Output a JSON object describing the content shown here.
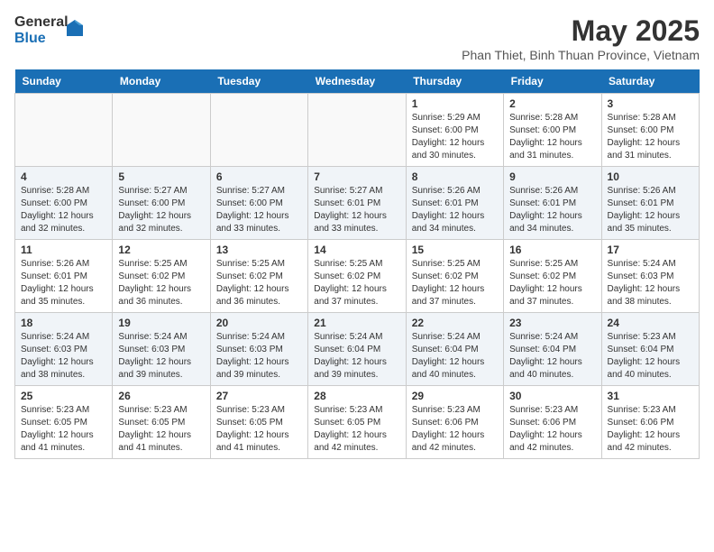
{
  "logo": {
    "text_general": "General",
    "text_blue": "Blue"
  },
  "title": "May 2025",
  "subtitle": "Phan Thiet, Binh Thuan Province, Vietnam",
  "days": [
    "Sunday",
    "Monday",
    "Tuesday",
    "Wednesday",
    "Thursday",
    "Friday",
    "Saturday"
  ],
  "weeks": [
    {
      "cells": [
        {
          "date": "",
          "info": ""
        },
        {
          "date": "",
          "info": ""
        },
        {
          "date": "",
          "info": ""
        },
        {
          "date": "",
          "info": ""
        },
        {
          "date": "1",
          "info": "Sunrise: 5:29 AM\nSunset: 6:00 PM\nDaylight: 12 hours\nand 30 minutes."
        },
        {
          "date": "2",
          "info": "Sunrise: 5:28 AM\nSunset: 6:00 PM\nDaylight: 12 hours\nand 31 minutes."
        },
        {
          "date": "3",
          "info": "Sunrise: 5:28 AM\nSunset: 6:00 PM\nDaylight: 12 hours\nand 31 minutes."
        }
      ]
    },
    {
      "cells": [
        {
          "date": "4",
          "info": "Sunrise: 5:28 AM\nSunset: 6:00 PM\nDaylight: 12 hours\nand 32 minutes."
        },
        {
          "date": "5",
          "info": "Sunrise: 5:27 AM\nSunset: 6:00 PM\nDaylight: 12 hours\nand 32 minutes."
        },
        {
          "date": "6",
          "info": "Sunrise: 5:27 AM\nSunset: 6:00 PM\nDaylight: 12 hours\nand 33 minutes."
        },
        {
          "date": "7",
          "info": "Sunrise: 5:27 AM\nSunset: 6:01 PM\nDaylight: 12 hours\nand 33 minutes."
        },
        {
          "date": "8",
          "info": "Sunrise: 5:26 AM\nSunset: 6:01 PM\nDaylight: 12 hours\nand 34 minutes."
        },
        {
          "date": "9",
          "info": "Sunrise: 5:26 AM\nSunset: 6:01 PM\nDaylight: 12 hours\nand 34 minutes."
        },
        {
          "date": "10",
          "info": "Sunrise: 5:26 AM\nSunset: 6:01 PM\nDaylight: 12 hours\nand 35 minutes."
        }
      ]
    },
    {
      "cells": [
        {
          "date": "11",
          "info": "Sunrise: 5:26 AM\nSunset: 6:01 PM\nDaylight: 12 hours\nand 35 minutes."
        },
        {
          "date": "12",
          "info": "Sunrise: 5:25 AM\nSunset: 6:02 PM\nDaylight: 12 hours\nand 36 minutes."
        },
        {
          "date": "13",
          "info": "Sunrise: 5:25 AM\nSunset: 6:02 PM\nDaylight: 12 hours\nand 36 minutes."
        },
        {
          "date": "14",
          "info": "Sunrise: 5:25 AM\nSunset: 6:02 PM\nDaylight: 12 hours\nand 37 minutes."
        },
        {
          "date": "15",
          "info": "Sunrise: 5:25 AM\nSunset: 6:02 PM\nDaylight: 12 hours\nand 37 minutes."
        },
        {
          "date": "16",
          "info": "Sunrise: 5:25 AM\nSunset: 6:02 PM\nDaylight: 12 hours\nand 37 minutes."
        },
        {
          "date": "17",
          "info": "Sunrise: 5:24 AM\nSunset: 6:03 PM\nDaylight: 12 hours\nand 38 minutes."
        }
      ]
    },
    {
      "cells": [
        {
          "date": "18",
          "info": "Sunrise: 5:24 AM\nSunset: 6:03 PM\nDaylight: 12 hours\nand 38 minutes."
        },
        {
          "date": "19",
          "info": "Sunrise: 5:24 AM\nSunset: 6:03 PM\nDaylight: 12 hours\nand 39 minutes."
        },
        {
          "date": "20",
          "info": "Sunrise: 5:24 AM\nSunset: 6:03 PM\nDaylight: 12 hours\nand 39 minutes."
        },
        {
          "date": "21",
          "info": "Sunrise: 5:24 AM\nSunset: 6:04 PM\nDaylight: 12 hours\nand 39 minutes."
        },
        {
          "date": "22",
          "info": "Sunrise: 5:24 AM\nSunset: 6:04 PM\nDaylight: 12 hours\nand 40 minutes."
        },
        {
          "date": "23",
          "info": "Sunrise: 5:24 AM\nSunset: 6:04 PM\nDaylight: 12 hours\nand 40 minutes."
        },
        {
          "date": "24",
          "info": "Sunrise: 5:23 AM\nSunset: 6:04 PM\nDaylight: 12 hours\nand 40 minutes."
        }
      ]
    },
    {
      "cells": [
        {
          "date": "25",
          "info": "Sunrise: 5:23 AM\nSunset: 6:05 PM\nDaylight: 12 hours\nand 41 minutes."
        },
        {
          "date": "26",
          "info": "Sunrise: 5:23 AM\nSunset: 6:05 PM\nDaylight: 12 hours\nand 41 minutes."
        },
        {
          "date": "27",
          "info": "Sunrise: 5:23 AM\nSunset: 6:05 PM\nDaylight: 12 hours\nand 41 minutes."
        },
        {
          "date": "28",
          "info": "Sunrise: 5:23 AM\nSunset: 6:05 PM\nDaylight: 12 hours\nand 42 minutes."
        },
        {
          "date": "29",
          "info": "Sunrise: 5:23 AM\nSunset: 6:06 PM\nDaylight: 12 hours\nand 42 minutes."
        },
        {
          "date": "30",
          "info": "Sunrise: 5:23 AM\nSunset: 6:06 PM\nDaylight: 12 hours\nand 42 minutes."
        },
        {
          "date": "31",
          "info": "Sunrise: 5:23 AM\nSunset: 6:06 PM\nDaylight: 12 hours\nand 42 minutes."
        }
      ]
    }
  ]
}
